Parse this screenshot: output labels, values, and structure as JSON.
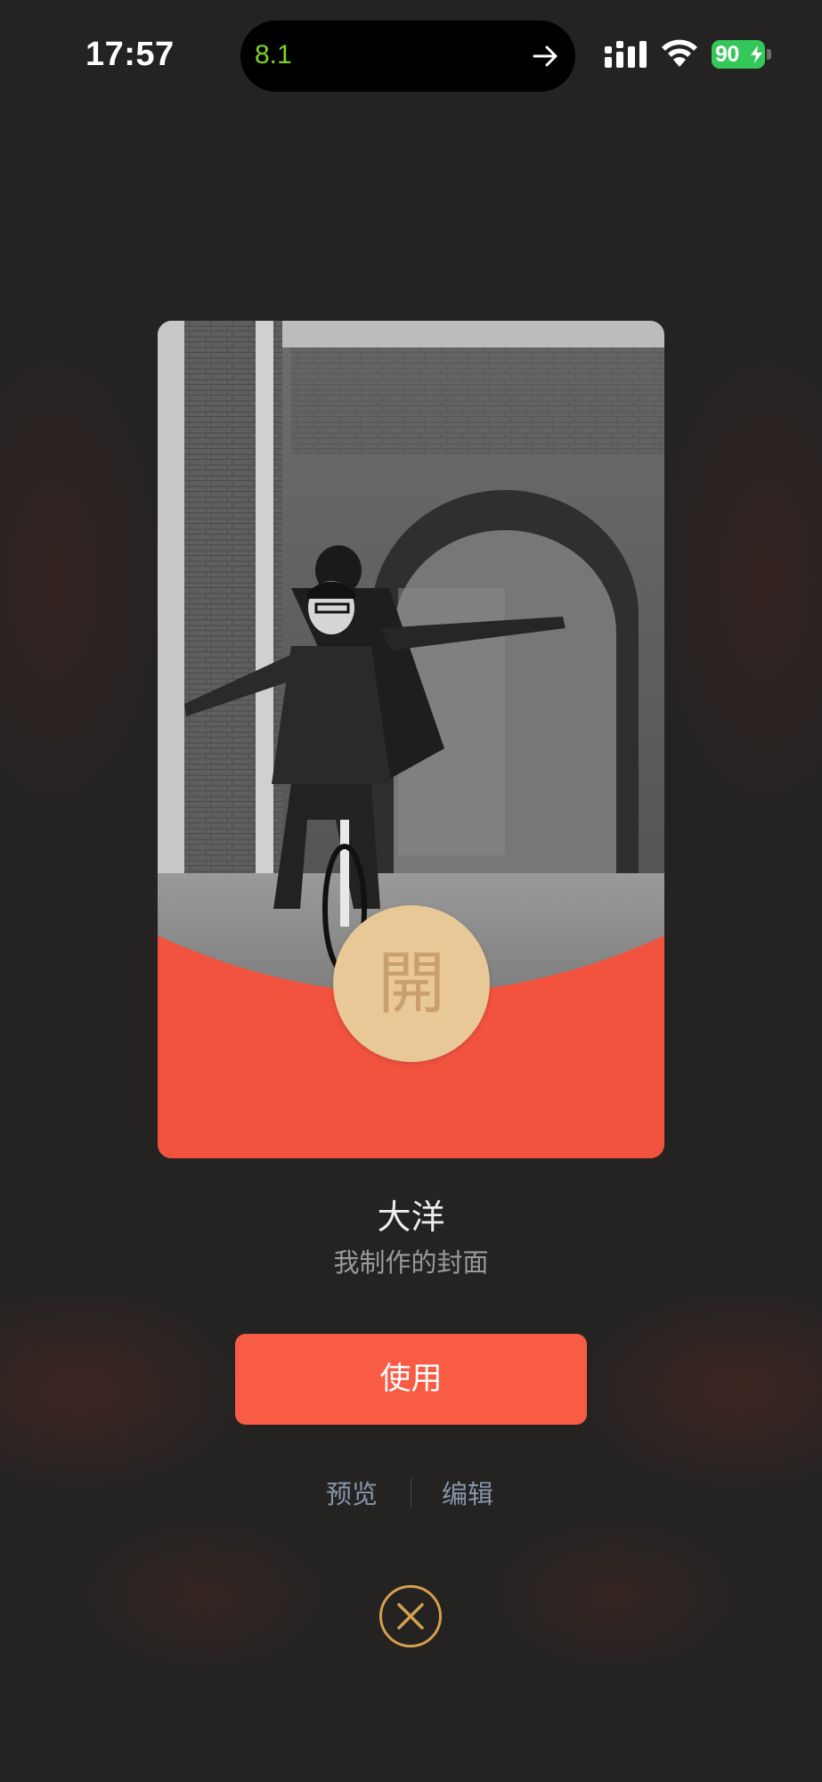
{
  "status_bar": {
    "time": "17:57",
    "island_value": "8.1",
    "battery_percent": "90",
    "icons": [
      "arrow-right-icon",
      "signal-icon",
      "wifi-icon",
      "battery-charging-icon"
    ]
  },
  "cover": {
    "open_glyph": "開",
    "title": "大洋",
    "subtitle": "我制作的封面",
    "colors": {
      "card_red": "#f2533f",
      "badge_gold": "#e9c897"
    }
  },
  "actions": {
    "use_label": "使用",
    "preview_label": "预览",
    "edit_label": "编辑",
    "close_icon": "close-icon",
    "colors": {
      "use_button": "#f85c45",
      "link": "#8795aa",
      "close_ring": "#d4a04c"
    }
  }
}
